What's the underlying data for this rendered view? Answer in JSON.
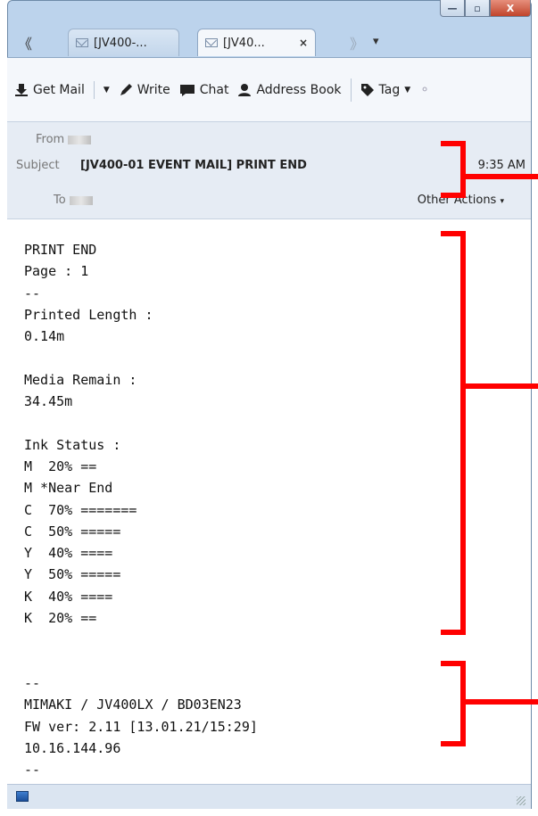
{
  "window": {
    "minimize_glyph": "—",
    "maximize_glyph": "▫",
    "close_glyph": "X"
  },
  "tabs": {
    "back_glyph": "《",
    "forward_glyph": "》",
    "list_glyph": "▾",
    "items": [
      {
        "label": "[JV400-..."
      },
      {
        "label": "[JV40...",
        "close": "×"
      }
    ]
  },
  "toolbar": {
    "get_mail": "Get Mail",
    "write": "Write",
    "chat": "Chat",
    "address_book": "Address Book",
    "tag": "Tag"
  },
  "header": {
    "from_label": "From",
    "subject_label": "Subject",
    "subject_value": "[JV400-01 EVENT MAIL] PRINT END",
    "to_label": "To",
    "time_partial": "9:35 AM",
    "other_actions": "Other Actions"
  },
  "body": {
    "lines": [
      "PRINT END",
      "Page : 1",
      "--",
      "Printed Length :",
      "0.14m",
      "",
      "Media Remain :",
      "34.45m",
      "",
      "Ink Status :",
      "M  20% ==",
      "M *Near End",
      "C  70% =======",
      "C  50% =====",
      "Y  40% ====",
      "Y  50% =====",
      "K  40% ====",
      "K  20% ==",
      "",
      "",
      "--",
      "MIMAKI / JV400LX / BD03EN23",
      "FW ver: 2.11 [13.01.21/15:29]",
      "10.16.144.96",
      "--"
    ]
  },
  "colors": {
    "annotation": "#ff0000",
    "window_frame": "#bcd3ec"
  }
}
